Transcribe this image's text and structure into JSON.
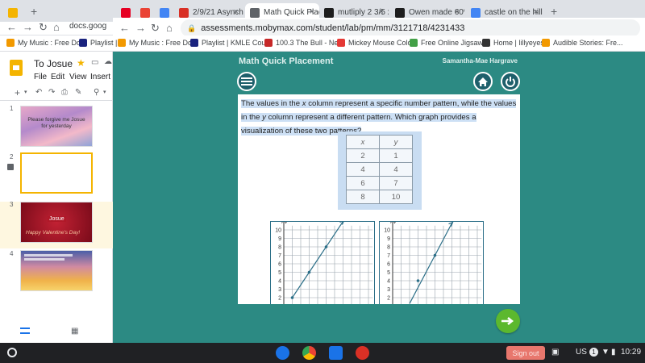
{
  "browser": {
    "tabs": [
      {
        "title": "",
        "favicon": "google-slides",
        "color": "#f4b400"
      },
      {
        "title": "",
        "favicon": "pinterest",
        "color": "#e60023"
      },
      {
        "title": "",
        "favicon": "gmail",
        "color": "#ea4335"
      },
      {
        "title": "",
        "favicon": "doc",
        "color": "#4285f4"
      },
      {
        "title": "2/9/21 Asynch -",
        "favicon": "asynch",
        "color": "#d93025"
      },
      {
        "title": "Math Quick Place",
        "favicon": "globe",
        "color": "#5f6368",
        "active": true
      },
      {
        "title": "mutliply 2 3/5 x",
        "favicon": "brainly",
        "color": "#1e1e1e"
      },
      {
        "title": "Owen made 60%",
        "favicon": "brainly",
        "color": "#1e1e1e"
      },
      {
        "title": "castle on the hill",
        "favicon": "google",
        "color": "#4285f4"
      }
    ],
    "new_tab_symbol": "+",
    "left_url": "docs.goog",
    "url": "assessments.mobymax.com/student/lab/pm/mm/3121718/4231433",
    "bookmarks": [
      {
        "label": "My Music : Free Do...",
        "color": "#f29900"
      },
      {
        "label": "Playlist |",
        "color": "#1a237e"
      },
      {
        "label": "My Music : Free Do...",
        "color": "#f29900"
      },
      {
        "label": "Playlist | KMLE Cou...",
        "color": "#1a237e"
      },
      {
        "label": "100.3 The Bull - Ne...",
        "color": "#c62828"
      },
      {
        "label": "Mickey Mouse Colo...",
        "color": "#e53935"
      },
      {
        "label": "Free Online Jigsaw...",
        "color": "#43a047"
      },
      {
        "label": "Home | lillyeyes",
        "color": "#333333"
      },
      {
        "label": "Audible Stories: Fre...",
        "color": "#f29900"
      }
    ]
  },
  "slides": {
    "doc_title": "To Josue",
    "menu": [
      "File",
      "Edit",
      "View",
      "Insert"
    ],
    "thumbnails": [
      {
        "num": "1",
        "text": "Please forgive me Josue for yesterday"
      },
      {
        "num": "2",
        "text": ""
      },
      {
        "num": "3",
        "text": "Josue",
        "sub": "Happy Valentine's Day!"
      },
      {
        "num": "4",
        "text": ""
      }
    ]
  },
  "moby": {
    "title": "Math Quick Placement",
    "user": "Samantha-Mae Hargrave",
    "question_parts": [
      "The values in the ",
      "x",
      " column represent a specific number pattern, while the values in the ",
      "y",
      " column represent a different pattern. Which graph provides a visualization of these two patterns?"
    ],
    "table": {
      "headers": [
        "x",
        "y"
      ],
      "rows": [
        [
          "2",
          "1"
        ],
        [
          "4",
          "4"
        ],
        [
          "6",
          "7"
        ],
        [
          "8",
          "10"
        ]
      ]
    },
    "graph_y_ticks": [
      "10",
      "9",
      "8",
      "7",
      "6",
      "5",
      "4",
      "3",
      "2"
    ],
    "graph_axis_label": "y",
    "graphs": [
      {
        "points": [
          [
            1,
            2
          ],
          [
            3,
            5
          ],
          [
            5,
            8
          ]
        ],
        "line": [
          [
            1,
            2
          ],
          [
            7,
            11
          ]
        ]
      },
      {
        "points": [
          [
            3,
            4
          ],
          [
            5,
            7
          ]
        ],
        "line": [
          [
            2,
            1.3
          ],
          [
            7,
            10.8
          ]
        ]
      }
    ]
  },
  "shelf": {
    "signout": "Sign out",
    "locale": "US",
    "notif": "1",
    "time": "10:29"
  }
}
